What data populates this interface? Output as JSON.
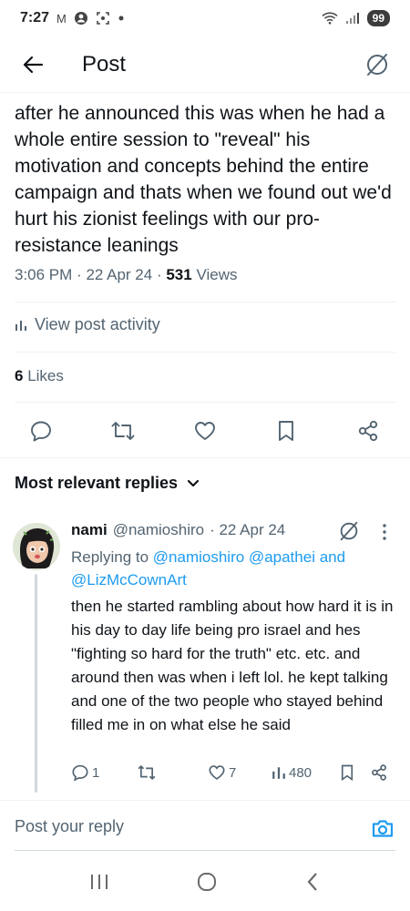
{
  "status_bar": {
    "time": "7:27",
    "indicators": "M",
    "battery": "99"
  },
  "header": {
    "title": "Post"
  },
  "post": {
    "text": "after he announced this was when he had a whole entire session to \"reveal\" his motivation and concepts behind the entire campaign and thats when we found out we'd hurt his zionist feelings with our pro-resistance leanings",
    "time": "3:06 PM",
    "date": "22 Apr 24",
    "views_count": "531",
    "views_label": "Views",
    "activity_label": "View post activity",
    "likes_count": "6",
    "likes_label": "Likes"
  },
  "replies_section": {
    "title": "Most relevant replies"
  },
  "reply": {
    "name": "nami",
    "handle": "@namioshiro",
    "date": "· 22 Apr 24",
    "replying_prefix": "Replying to",
    "replying_to_1": "@namioshiro",
    "replying_to_2": "@apathei",
    "replying_and": "and",
    "replying_to_3": "@LizMcCownArt",
    "text": "then he started rambling about how hard it is in his day to day life being pro israel and hes \"fighting so hard for the truth\" etc. etc. and around then was when i left lol. he kept talking and one of the two people who stayed behind filled me in on what else he said",
    "reply_count": "1",
    "like_count": "7",
    "view_count": "480"
  },
  "composer": {
    "placeholder": "Post your reply"
  },
  "colors": {
    "accent": "#1d9bf0",
    "muted": "#536471",
    "text": "#0f1419"
  }
}
